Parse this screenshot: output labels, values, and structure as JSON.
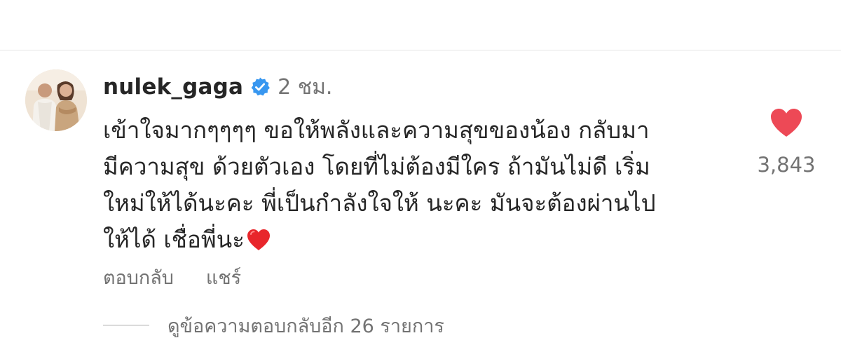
{
  "comment": {
    "username": "nulek_gaga",
    "verified": true,
    "timestamp": "2 ชม.",
    "lines": [
      "เข้าใจมากๆๆๆๆ  ขอให้พลังและความสุขของน้อง กลับมา",
      "มีความสุข ด้วยตัวเอง โดยที่ไม่ต้องมีใคร ถ้ามันไม่ดี  เริ่ม",
      "ใหม่ให้ได้นะคะ พี่เป็นกำลังใจให้  นะคะ มันจะต้องผ่านไป",
      "ให้ได้  เชื่อพี่นะ"
    ],
    "trailing_emoji": "red-heart",
    "like_count": "3,843",
    "liked": true
  },
  "actions": {
    "reply_label": "ตอบกลับ",
    "share_label": "แชร์"
  },
  "replies": {
    "view_label": "ดูข้อความตอบกลับอีก 26 รายการ"
  },
  "icons": {
    "verified": "verified-badge-icon",
    "like": "heart-icon",
    "emoji": "red-heart-emoji"
  },
  "colors": {
    "text_primary": "#262626",
    "text_secondary": "#737373",
    "verified_blue": "#3897f0",
    "like_red": "#ed4956",
    "divider": "#e6e6e6"
  }
}
